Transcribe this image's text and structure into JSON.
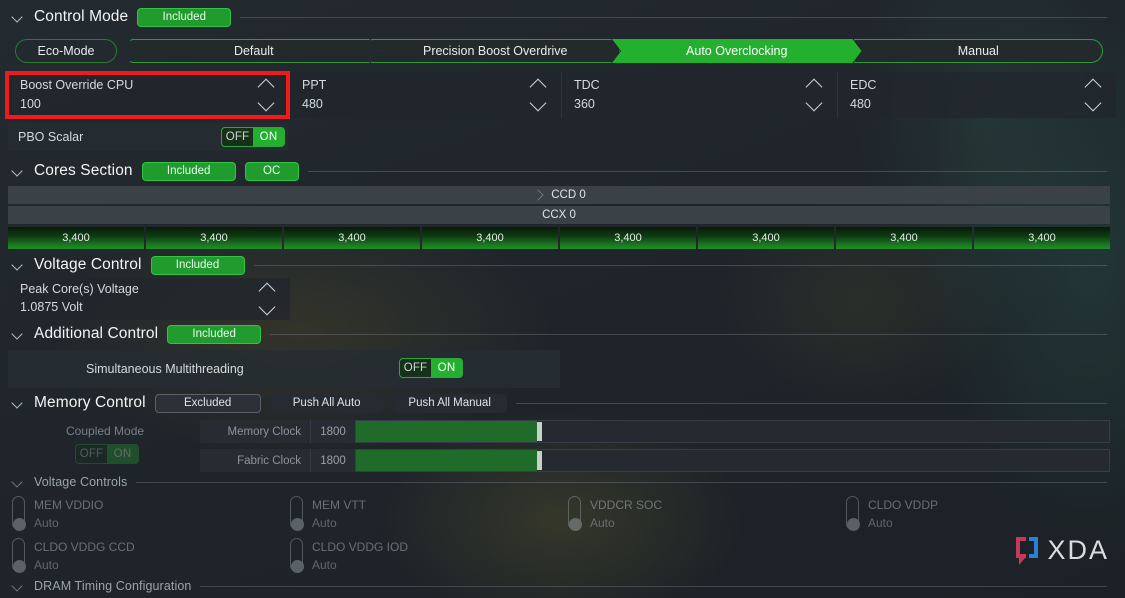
{
  "control_mode": {
    "title": "Control Mode",
    "badge": "Included",
    "modes": [
      {
        "label": "Eco-Mode",
        "active": false
      },
      {
        "label": "Default",
        "active": false
      },
      {
        "label": "Precision Boost Overdrive",
        "active": false
      },
      {
        "label": "Auto Overclocking",
        "active": true
      },
      {
        "label": "Manual",
        "active": false
      }
    ],
    "fields": [
      {
        "label": "Boost Override CPU",
        "value": "100",
        "highlighted": true
      },
      {
        "label": "PPT",
        "value": "480",
        "highlighted": false
      },
      {
        "label": "TDC",
        "value": "360",
        "highlighted": false
      },
      {
        "label": "EDC",
        "value": "480",
        "highlighted": false
      }
    ],
    "pbo_scalar": {
      "label": "PBO Scalar",
      "off": "OFF",
      "on": "ON",
      "state": "ON"
    }
  },
  "cores_section": {
    "title": "Cores Section",
    "badge": "Included",
    "oc_badge": "OC",
    "ccd_label": "CCD 0",
    "ccx_label": "CCX 0",
    "core_values": [
      "3,400",
      "3,400",
      "3,400",
      "3,400",
      "3,400",
      "3,400",
      "3,400",
      "3,400"
    ]
  },
  "voltage_control": {
    "title": "Voltage Control",
    "badge": "Included",
    "field": {
      "label": "Peak Core(s) Voltage",
      "value": "1.0875 Volt"
    }
  },
  "additional_control": {
    "title": "Additional Control",
    "badge": "Included",
    "smt": {
      "label": "Simultaneous Multithreading",
      "off": "OFF",
      "on": "ON",
      "state": "ON"
    }
  },
  "memory_control": {
    "title": "Memory Control",
    "badge": "Excluded",
    "push_all_auto": "Push All Auto",
    "push_all_manual": "Push All Manual",
    "coupled_mode": {
      "label": "Coupled Mode",
      "off": "OFF",
      "on": "ON",
      "state": "ON"
    },
    "sliders": [
      {
        "label": "Memory Clock",
        "value": "1800"
      },
      {
        "label": "Fabric Clock",
        "value": "1800"
      }
    ]
  },
  "voltage_controls": {
    "title": "Voltage Controls",
    "items": [
      {
        "name": "MEM VDDIO",
        "value": "Auto"
      },
      {
        "name": "MEM VTT",
        "value": "Auto"
      },
      {
        "name": "VDDCR SOC",
        "value": "Auto"
      },
      {
        "name": "CLDO VDDP",
        "value": "Auto"
      },
      {
        "name": "CLDO VDDG CCD",
        "value": "Auto"
      },
      {
        "name": "CLDO VDDG IOD",
        "value": "Auto"
      }
    ]
  },
  "dram_timing": {
    "title": "DRAM Timing Configuration"
  },
  "watermark": {
    "text": "XDA",
    "bracket_left_color": "#c43a5c",
    "bracket_right_color": "#2b7fd4"
  },
  "colors": {
    "accent_green": "#22b02e",
    "badge_green": "#1f9c2d",
    "highlight_red": "#f0191e",
    "panel": "#262c32",
    "background": "#1f252b"
  }
}
